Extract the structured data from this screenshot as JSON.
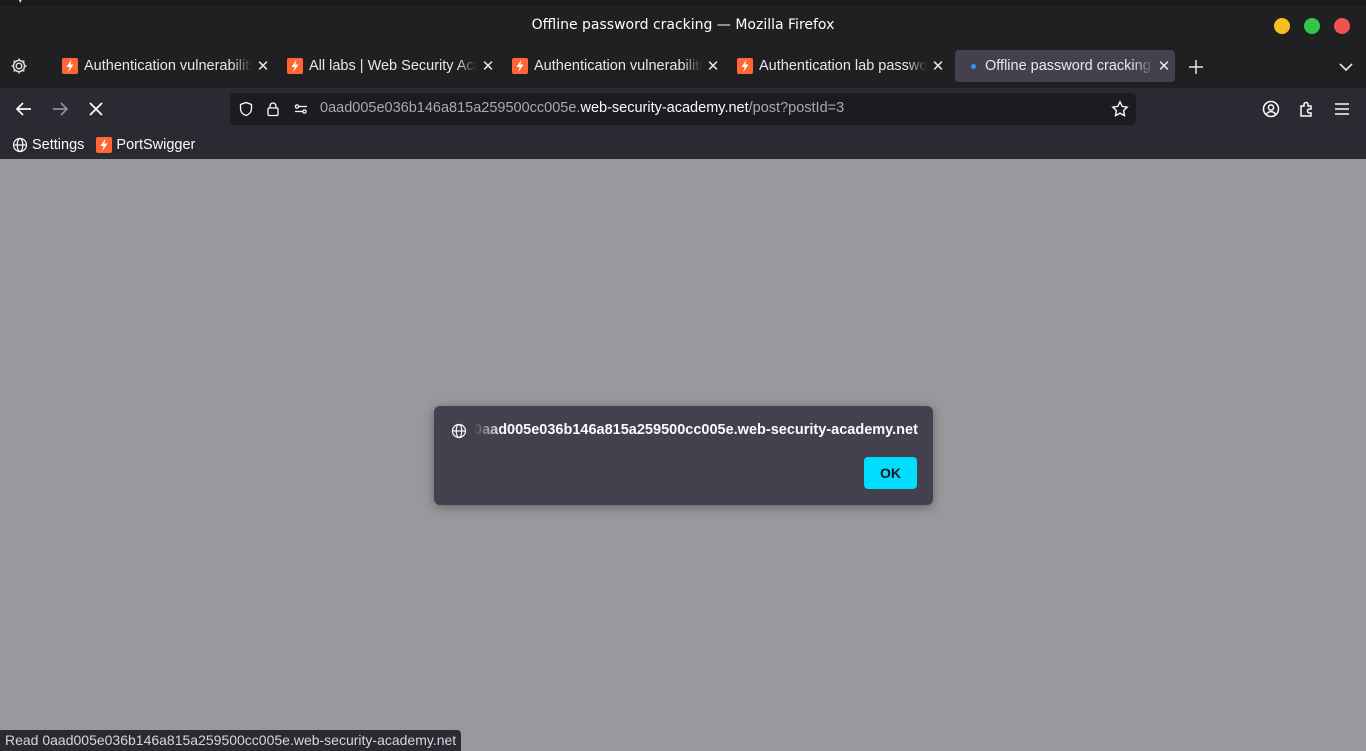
{
  "window": {
    "title": "Offline password cracking — Mozilla Firefox"
  },
  "tabs": [
    {
      "label": "Authentication vulnerabilities",
      "active": false
    },
    {
      "label": "All labs | Web Security Academy",
      "active": false
    },
    {
      "label": "Authentication vulnerabilities",
      "active": false
    },
    {
      "label": "Authentication lab passwords",
      "active": false
    },
    {
      "label": "Offline password cracking",
      "active": true
    }
  ],
  "urlbar": {
    "prefix": "0aad005e036b146a815a259500cc005e.",
    "domain": "web-security-academy.net",
    "path": "/post?postId=3"
  },
  "bookmarks": [
    {
      "label": "Settings",
      "icon": "globe-icon"
    },
    {
      "label": "PortSwigger",
      "icon": "portswigger-icon"
    }
  ],
  "dialog": {
    "origin": "0aad005e036b146a815a259500cc005e.web-security-academy.net",
    "ok_label": "OK"
  },
  "status": {
    "text": "Read 0aad005e036b146a815a259500cc005e.web-security-academy.net"
  },
  "colors": {
    "accent": "#00ddff",
    "portswigger_orange": "#ff6633",
    "loading_dot": "#3a8ff7",
    "content_bg": "#99989c"
  }
}
